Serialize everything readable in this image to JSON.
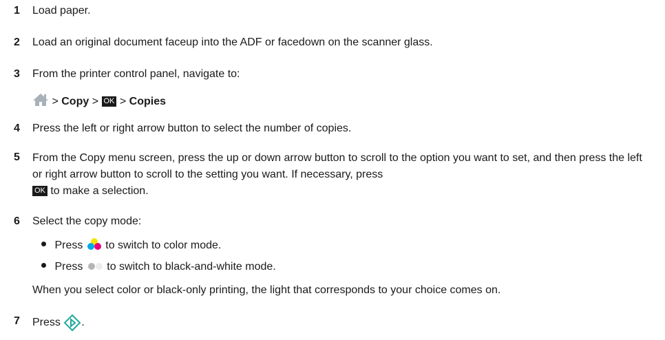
{
  "steps": [
    {
      "num": "1",
      "text": "Load paper."
    },
    {
      "num": "2",
      "text": "Load an original document faceup into the ADF or facedown on the scanner glass."
    },
    {
      "num": "3",
      "text": "From the printer control panel, navigate to:"
    },
    {
      "num": "4",
      "text": "Press the left or right arrow button to select the number of copies."
    },
    {
      "num": "5",
      "text": "From the Copy menu screen, press the up or down arrow button to scroll to the option you want to set, and then press the left or right arrow button to scroll to the setting you want. If necessary, press",
      "text_after": " to make a selection."
    },
    {
      "num": "6",
      "text": "Select the copy mode:"
    },
    {
      "num": "7",
      "text": "Press",
      "text_after": "."
    }
  ],
  "nav_path": {
    "sep": ">",
    "copy": "Copy",
    "ok": "OK",
    "copies": "Copies"
  },
  "ok_label": "OK",
  "bullets": {
    "press": "Press",
    "color_text": "to switch to color mode.",
    "bw_text": "to switch to black-and-white mode."
  },
  "note": "When you select color or black-only printing, the light that corresponds to your choice comes on.",
  "icons": {
    "home": "home-icon",
    "color": "color-mode-icon",
    "bw": "black-white-mode-icon",
    "start": "start-icon"
  },
  "colors": {
    "text": "#1a1a1a",
    "home_icon": "#a9b1b8",
    "color_yellow": "#f7e400",
    "color_cyan": "#00a9e8",
    "color_magenta": "#e6007e",
    "bw_dot": "#b5b5b5",
    "start_icon": "#1fa89a"
  }
}
